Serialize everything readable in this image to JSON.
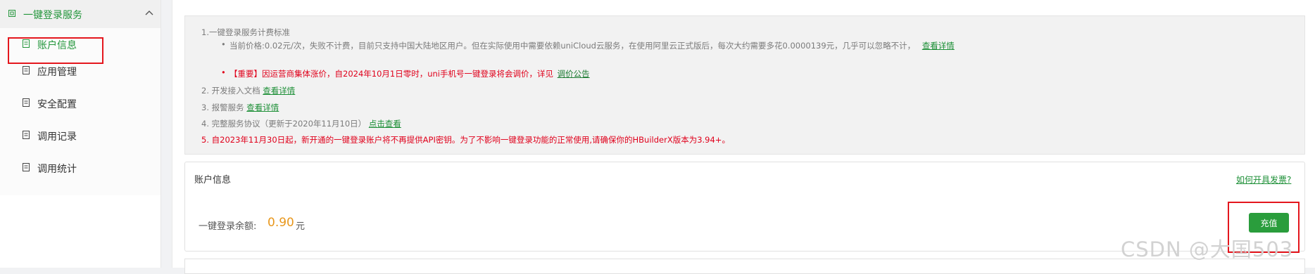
{
  "sidebar": {
    "header": {
      "label": "一键登录服务",
      "icon": "service-icon",
      "chevron": "chevron-up-icon"
    },
    "items": [
      {
        "label": "账户信息",
        "icon": "doc-icon",
        "active": true
      },
      {
        "label": "应用管理",
        "icon": "doc-icon"
      },
      {
        "label": "安全配置",
        "icon": "doc-icon"
      },
      {
        "label": "调用记录",
        "icon": "doc-icon"
      },
      {
        "label": "调用统计",
        "icon": "doc-icon"
      }
    ]
  },
  "notice": {
    "l1": "1.一键登录服务计费标准",
    "l2": "当前价格:0.02元/次，失败不计费，目前只支持中国大陆地区用户。但在实际使用中需要依赖uniCloud云服务，在使用阿里云正式版后，每次大约需要多花0.0000139元，几乎可以忽略不计，",
    "l2_link": "查看详情",
    "l3": "【重要】因运营商集体涨价，自2024年10月1日零时，uni手机号一键登录将会调价，详见",
    "l3_link": "调价公告",
    "l4": "2. 开发接入文档",
    "l4_link": "查看详情",
    "l5": "3. 报警服务",
    "l5_link": "查看详情",
    "l6": "4. 完整服务协议（更新于2020年11月10日）",
    "l6_link": "点击查看",
    "l7": "5. 自2023年11月30日起，新开通的一键登录账户将不再提供API密钥。为了不影响一键登录功能的正常使用,请确保你的HBuilderX版本为3.94+。"
  },
  "account": {
    "title": "账户信息",
    "invoice_link": "如何开具发票?",
    "balance_label": "一键登录余额:",
    "balance_value": "0.90",
    "balance_unit": "元",
    "recharge_button": "充值"
  },
  "watermark": "CSDN @大国503",
  "colors": {
    "accent": "#23963b",
    "warning": "#e0001b",
    "balance": "#e8971c",
    "highlight_box": "#e4161d"
  }
}
